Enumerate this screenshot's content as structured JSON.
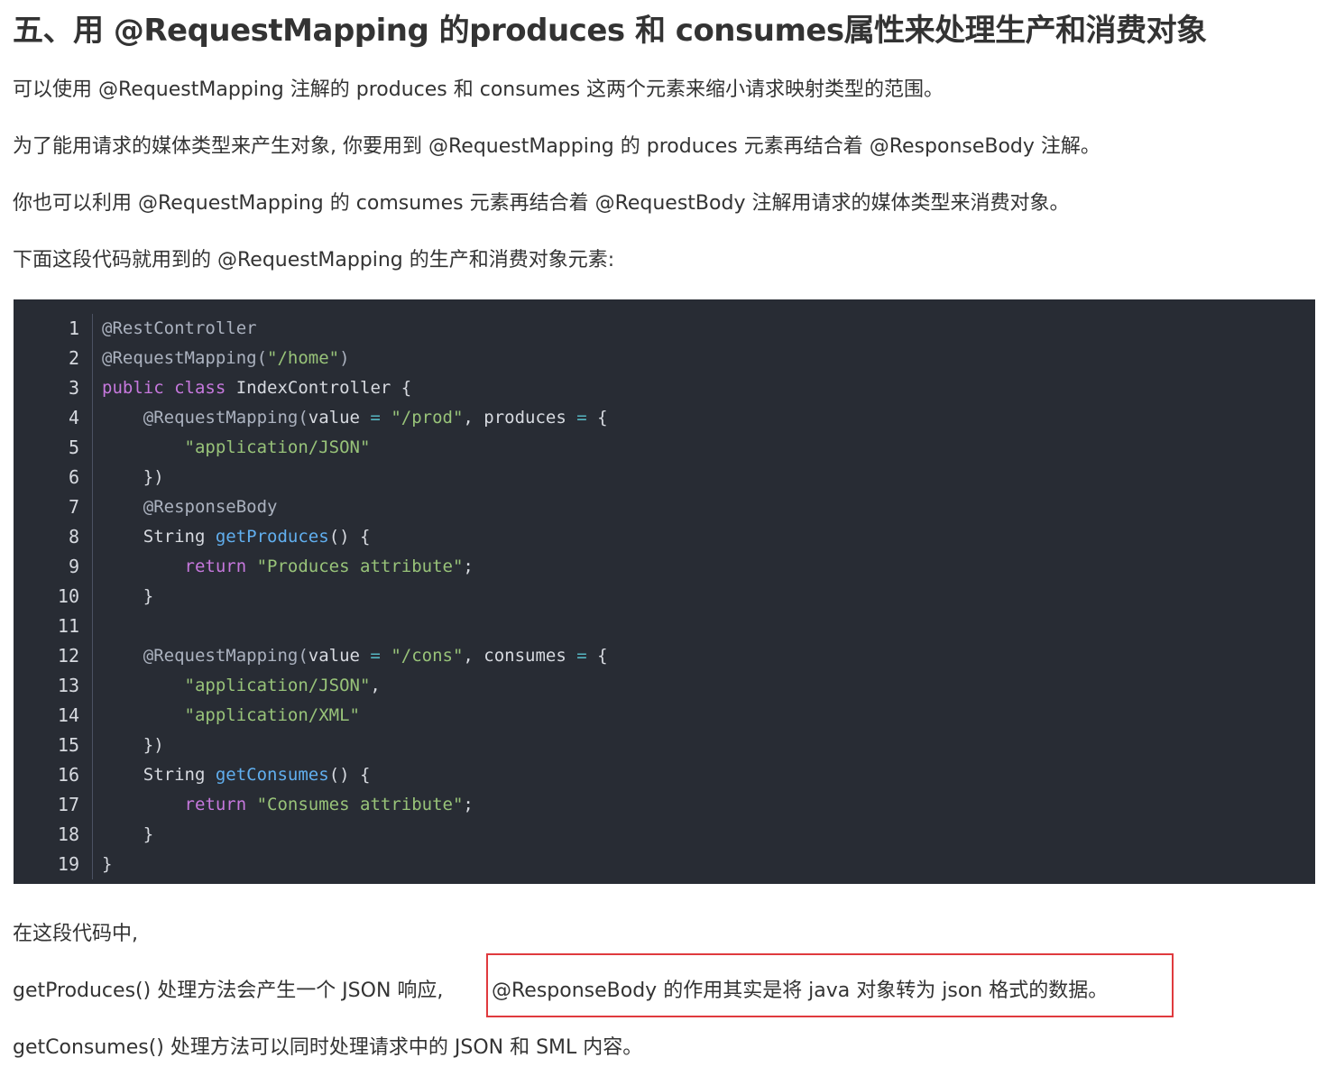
{
  "heading": "五、用 @RequestMapping 的produces 和 consumes属性来处理生产和消费对象",
  "paragraphs": {
    "p1": "可以使用 @RequestMapping 注解的 produces 和 consumes 这两个元素来缩小请求映射类型的范围。",
    "p2": "为了能用请求的媒体类型来产生对象, 你要用到 @RequestMapping 的 produces 元素再结合着 @ResponseBody 注解。",
    "p3": "你也可以利用 @RequestMapping 的 comsumes 元素再结合着 @RequestBody 注解用请求的媒体类型来消费对象。",
    "p4": "下面这段代码就用到的 @RequestMapping 的生产和消费对象元素:",
    "p5": "在这段代码中,",
    "p6_prefix": "getProduces() 处理方法会产生一个 JSON 响应,",
    "p6_highlight": "@ResponseBody 的作用其实是将 java 对象转为 json 格式的数据。",
    "p7": "getConsumes() 处理方法可以同时处理请求中的 JSON 和 SML 内容。"
  },
  "code": {
    "line_numbers": [
      "1",
      "2",
      "3",
      "4",
      "5",
      "6",
      "7",
      "8",
      "9",
      "10",
      "11",
      "12",
      "13",
      "14",
      "15",
      "16",
      "17",
      "18",
      "19"
    ],
    "lines": [
      [
        {
          "t": "@RestController",
          "c": "ann"
        }
      ],
      [
        {
          "t": "@RequestMapping(",
          "c": "ann"
        },
        {
          "t": "\"/home\"",
          "c": "str"
        },
        {
          "t": ")",
          "c": "ann"
        }
      ],
      [
        {
          "t": "public",
          "c": "kw"
        },
        {
          "t": " ",
          "c": "plain"
        },
        {
          "t": "class",
          "c": "kw"
        },
        {
          "t": " IndexController {",
          "c": "plain"
        }
      ],
      [
        {
          "t": "    @RequestMapping(",
          "c": "ann"
        },
        {
          "t": "value ",
          "c": "plain"
        },
        {
          "t": "=",
          "c": "op"
        },
        {
          "t": " ",
          "c": "plain"
        },
        {
          "t": "\"/prod\"",
          "c": "str"
        },
        {
          "t": ", produces ",
          "c": "plain"
        },
        {
          "t": "=",
          "c": "op"
        },
        {
          "t": " {",
          "c": "plain"
        }
      ],
      [
        {
          "t": "        ",
          "c": "plain"
        },
        {
          "t": "\"application/JSON\"",
          "c": "str"
        }
      ],
      [
        {
          "t": "    })",
          "c": "plain"
        }
      ],
      [
        {
          "t": "    @ResponseBody",
          "c": "ann"
        }
      ],
      [
        {
          "t": "    String ",
          "c": "plain"
        },
        {
          "t": "getProduces",
          "c": "fn"
        },
        {
          "t": "() {",
          "c": "plain"
        }
      ],
      [
        {
          "t": "        ",
          "c": "plain"
        },
        {
          "t": "return",
          "c": "kw"
        },
        {
          "t": " ",
          "c": "plain"
        },
        {
          "t": "\"Produces attribute\"",
          "c": "str"
        },
        {
          "t": ";",
          "c": "plain"
        }
      ],
      [
        {
          "t": "    }",
          "c": "plain"
        }
      ],
      [
        {
          "t": "",
          "c": "plain"
        }
      ],
      [
        {
          "t": "    @RequestMapping(",
          "c": "ann"
        },
        {
          "t": "value ",
          "c": "plain"
        },
        {
          "t": "=",
          "c": "op"
        },
        {
          "t": " ",
          "c": "plain"
        },
        {
          "t": "\"/cons\"",
          "c": "str"
        },
        {
          "t": ", consumes ",
          "c": "plain"
        },
        {
          "t": "=",
          "c": "op"
        },
        {
          "t": " {",
          "c": "plain"
        }
      ],
      [
        {
          "t": "        ",
          "c": "plain"
        },
        {
          "t": "\"application/JSON\"",
          "c": "str"
        },
        {
          "t": ",",
          "c": "plain"
        }
      ],
      [
        {
          "t": "        ",
          "c": "plain"
        },
        {
          "t": "\"application/XML\"",
          "c": "str"
        }
      ],
      [
        {
          "t": "    })",
          "c": "plain"
        }
      ],
      [
        {
          "t": "    String ",
          "c": "plain"
        },
        {
          "t": "getConsumes",
          "c": "fn"
        },
        {
          "t": "() {",
          "c": "plain"
        }
      ],
      [
        {
          "t": "        ",
          "c": "plain"
        },
        {
          "t": "return",
          "c": "kw"
        },
        {
          "t": " ",
          "c": "plain"
        },
        {
          "t": "\"Consumes attribute\"",
          "c": "str"
        },
        {
          "t": ";",
          "c": "plain"
        }
      ],
      [
        {
          "t": "    }",
          "c": "plain"
        }
      ],
      [
        {
          "t": "}",
          "c": "plain"
        }
      ]
    ]
  },
  "colors": {
    "code_background": "#282c34",
    "highlight_border": "#e03a3e",
    "string": "#98c379",
    "keyword": "#c678dd",
    "function": "#61afef"
  }
}
